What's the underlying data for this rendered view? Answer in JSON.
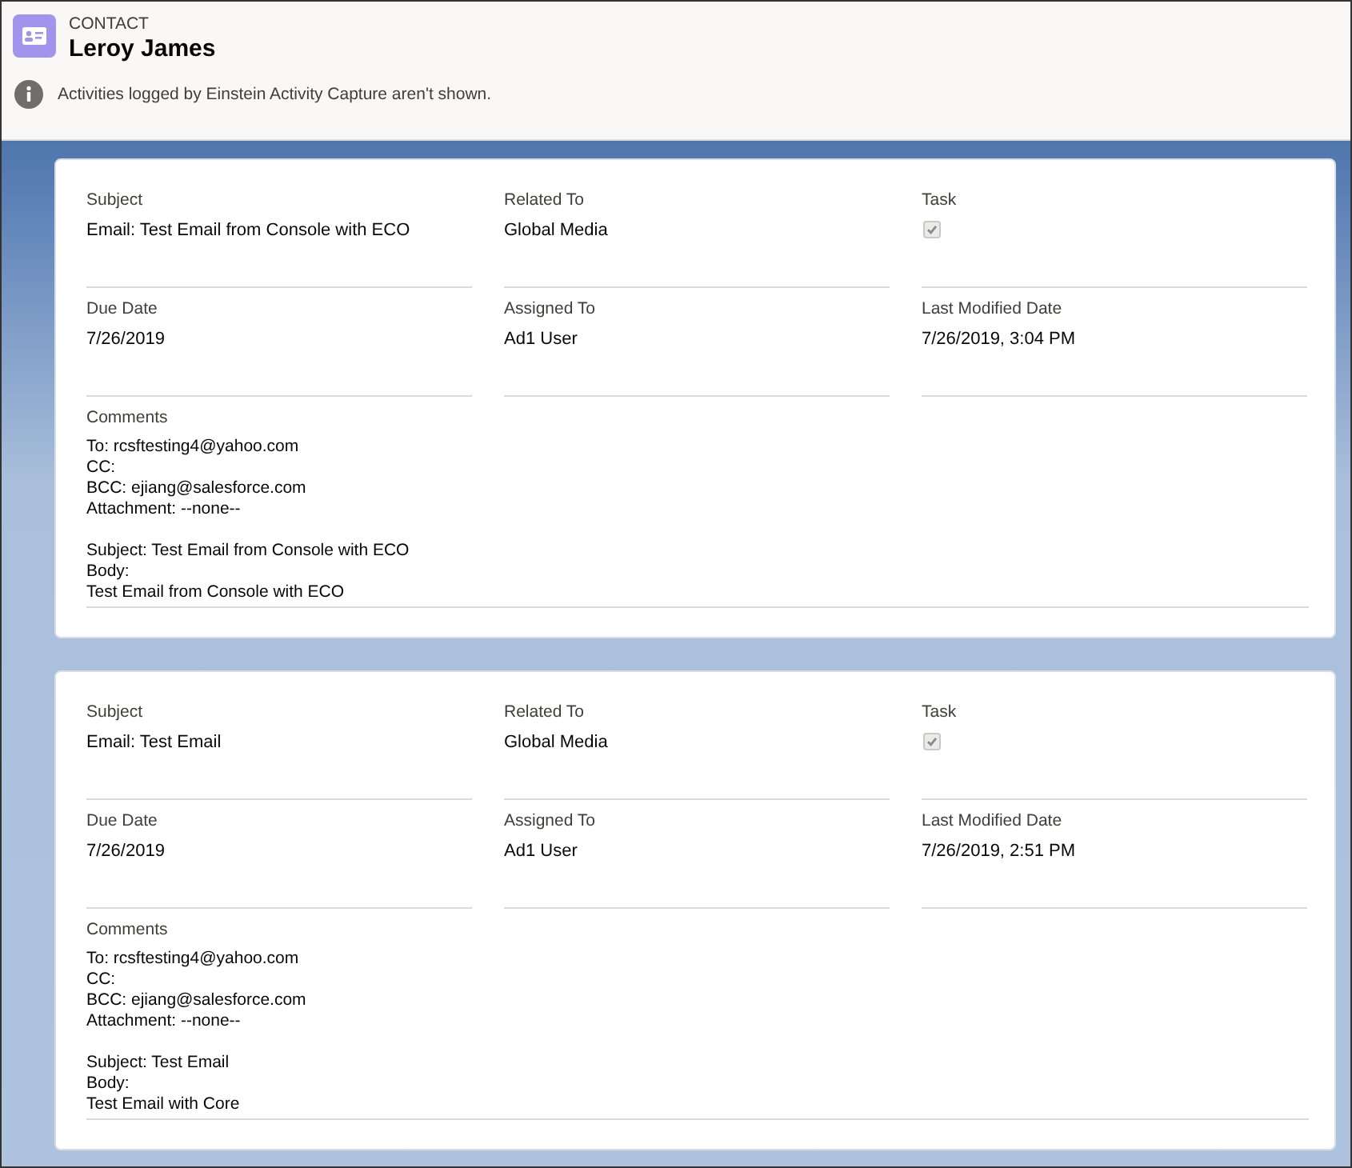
{
  "header": {
    "object_type": "CONTACT",
    "name": "Leroy James",
    "notice": "Activities logged by Einstein Activity Capture aren't shown."
  },
  "activities": [
    {
      "fields": [
        {
          "kind": "text",
          "label": "Subject",
          "value": "Email: Test Email from Console with ECO"
        },
        {
          "kind": "text",
          "label": "Related To",
          "value": "Global Media"
        },
        {
          "kind": "checkbox",
          "label": "Task",
          "checked": true
        },
        {
          "kind": "text",
          "label": "Due Date",
          "value": "7/26/2019"
        },
        {
          "kind": "text",
          "label": "Assigned To",
          "value": "Ad1 User"
        },
        {
          "kind": "text",
          "label": "Last Modified Date",
          "value": "7/26/2019, 3:04 PM"
        }
      ],
      "comments": {
        "label": "Comments",
        "paragraphs": [
          "To: rcsftesting4@yahoo.com\nCC:\nBCC: ejiang@salesforce.com\nAttachment: --none--",
          "Subject: Test Email from Console with ECO\nBody:\nTest Email from Console with ECO"
        ]
      }
    },
    {
      "fields": [
        {
          "kind": "text",
          "label": "Subject",
          "value": "Email: Test Email"
        },
        {
          "kind": "text",
          "label": "Related To",
          "value": "Global Media"
        },
        {
          "kind": "checkbox",
          "label": "Task",
          "checked": true
        },
        {
          "kind": "text",
          "label": "Due Date",
          "value": "7/26/2019"
        },
        {
          "kind": "text",
          "label": "Assigned To",
          "value": "Ad1 User"
        },
        {
          "kind": "text",
          "label": "Last Modified Date",
          "value": "7/26/2019, 2:51 PM"
        }
      ],
      "comments": {
        "label": "Comments",
        "paragraphs": [
          "To: rcsftesting4@yahoo.com\nCC:\nBCC: ejiang@salesforce.com\nAttachment: --none--",
          "Subject: Test Email\nBody:\nTest Email with Core"
        ]
      }
    }
  ]
}
